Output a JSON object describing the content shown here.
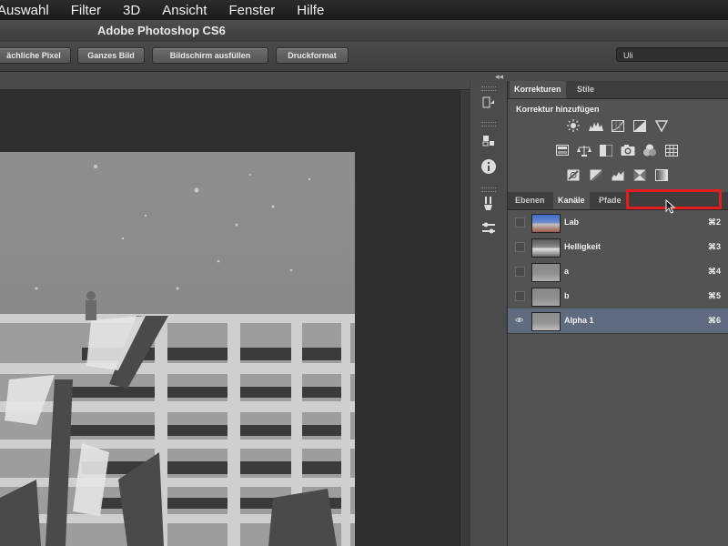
{
  "menu": [
    "Auswahl",
    "Filter",
    "3D",
    "Ansicht",
    "Fenster",
    "Hilfe"
  ],
  "app_title": "Adobe Photoshop CS6",
  "options_bar": {
    "buttons": [
      "ächliche Pixel",
      "Ganzes Bild",
      "Bildschirm ausfüllen",
      "Druckformat"
    ],
    "workspace": "Uli"
  },
  "adjust_panel": {
    "tabs": [
      "Korrekturen",
      "Stile"
    ],
    "active_tab": 0,
    "heading": "Korrektur hinzufügen",
    "icons_row1": [
      "brightness-icon",
      "levels-icon",
      "curves-icon",
      "exposure-icon",
      "vibrance-icon"
    ],
    "icons_row2": [
      "hue-saturation-icon",
      "color-balance-icon",
      "black-white-icon",
      "photo-filter-icon",
      "channel-mixer-icon",
      "color-lookup-icon"
    ],
    "icons_row3": [
      "invert-icon",
      "posterize-icon",
      "threshold-icon",
      "gradient-map-icon",
      "selective-color-icon"
    ]
  },
  "layers_panel": {
    "tabs": [
      "Ebenen",
      "Kanäle",
      "Pfade"
    ],
    "active_tab": 1,
    "channels": [
      {
        "name": "Lab",
        "shortcut": "⌘2",
        "visible": false,
        "selected": false,
        "thumb": "color"
      },
      {
        "name": "Helligkeit",
        "shortcut": "⌘3",
        "visible": false,
        "selected": false,
        "thumb": "light"
      },
      {
        "name": "a",
        "shortcut": "⌘4",
        "visible": false,
        "selected": false,
        "thumb": "gray"
      },
      {
        "name": "b",
        "shortcut": "⌘5",
        "visible": false,
        "selected": false,
        "thumb": "gray"
      },
      {
        "name": "Alpha 1",
        "shortcut": "⌘6",
        "visible": true,
        "selected": true,
        "thumb": "gray"
      }
    ]
  },
  "colors": {
    "highlight": "#e41d1d",
    "selected_row": "#5f6c80"
  }
}
